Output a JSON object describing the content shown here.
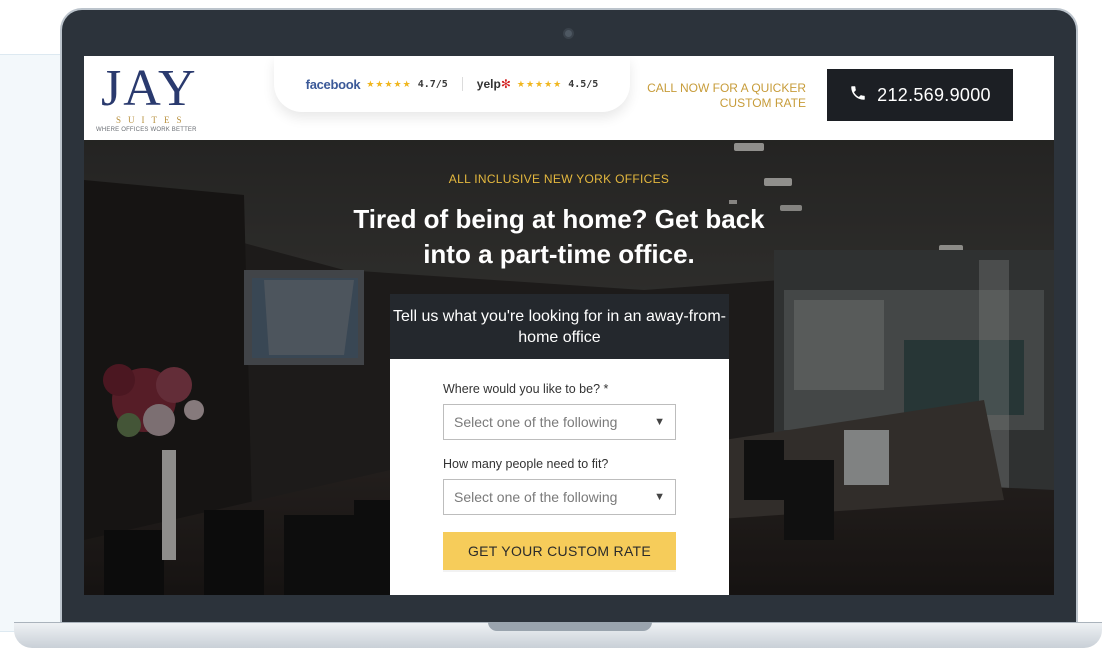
{
  "header": {
    "logo": {
      "main": "JAY",
      "sub": "SUITES",
      "tagline": "WHERE OFFICES WORK BETTER"
    },
    "ratings": [
      {
        "brand": "facebook",
        "stars": "★★★★★",
        "score": "4.7/5"
      },
      {
        "brand": "yelp",
        "stars": "★★★★★",
        "score": "4.5/5"
      }
    ],
    "call_text": "CALL NOW FOR A QUICKER CUSTOM RATE",
    "phone": "212.569.9000"
  },
  "hero": {
    "eyebrow": "ALL INCLUSIVE NEW YORK OFFICES",
    "headline": "Tired of being at home? Get back into a part-time office."
  },
  "form": {
    "heading": "Tell us what you're looking for in an away-from-home office",
    "location_label": "Where would you like to be? *",
    "location_value": "Select one of the following",
    "people_label": "How many people need to fit?",
    "people_value": "Select one of the following",
    "submit_label": "GET YOUR CUSTOM RATE"
  },
  "colors": {
    "accent_gold": "#e4b83e",
    "button_yellow": "#f6cc5a",
    "dark_panel": "#24282d",
    "logo_navy": "#2a3a6e",
    "facebook_blue": "#3b5998",
    "yelp_red": "#d32323"
  },
  "icons": [
    "phone-icon",
    "caret-down-icon",
    "star-icon",
    "camera-icon"
  ]
}
